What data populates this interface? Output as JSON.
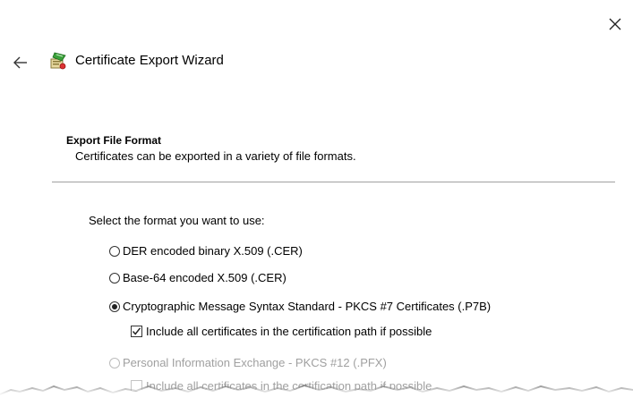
{
  "window": {
    "title": "Certificate Export Wizard"
  },
  "icons": {
    "close": "close-icon",
    "back": "back-arrow-icon",
    "wizard": "certificate-wizard-icon"
  },
  "section": {
    "heading": "Export File Format",
    "description": "Certificates can be exported in a variety of file formats."
  },
  "format": {
    "prompt": "Select the format you want to use:",
    "options": [
      {
        "label": "DER encoded binary X.509 (.CER)",
        "selected": false,
        "enabled": true
      },
      {
        "label": "Base-64 encoded X.509 (.CER)",
        "selected": false,
        "enabled": true
      },
      {
        "label": "Cryptographic Message Syntax Standard - PKCS #7 Certificates (.P7B)",
        "selected": true,
        "enabled": true
      },
      {
        "label": "Personal Information Exchange - PKCS #12 (.PFX)",
        "selected": false,
        "enabled": false
      }
    ],
    "p7b_include": {
      "label": "Include all certificates in the certification path if possible",
      "checked": true,
      "enabled": true
    },
    "pfx_include": {
      "label": "Include all certificates in the certification path if possible",
      "checked": false,
      "enabled": false
    }
  },
  "colors": {
    "background": "#ffffff",
    "text": "#000000",
    "disabled_text": "#a0a0a0",
    "divider": "#a0a0a0"
  }
}
